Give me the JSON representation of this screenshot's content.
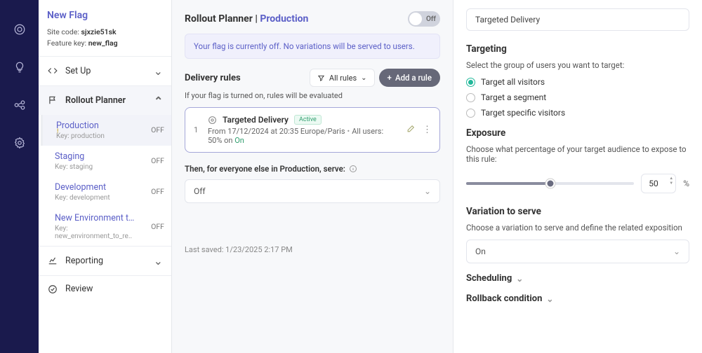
{
  "sidebar": {
    "title": "New Flag",
    "site_code_label": "Site code:",
    "site_code": "sjxzie51sk",
    "feature_key_label": "Feature key:",
    "feature_key": "new_flag",
    "setup": "Set Up",
    "rollout": "Rollout Planner",
    "reporting": "Reporting",
    "review": "Review",
    "envs": [
      {
        "name": "Production",
        "key": "Key: production",
        "status": "OFF"
      },
      {
        "name": "Staging",
        "key": "Key: staging",
        "status": "OFF"
      },
      {
        "name": "Development",
        "key": "Key: development",
        "status": "OFF"
      },
      {
        "name": "New Environment to re...",
        "key": "Key: new_environment_to_re..",
        "status": "OFF"
      }
    ]
  },
  "main": {
    "title_pre": "Rollout Planner | ",
    "title_env": "Production",
    "toggle_label": "Off",
    "notice": "Your flag is currently off. No variations will be served to users.",
    "delivery_title": "Delivery rules",
    "filter_label": "All rules",
    "add_rule_label": "Add a rule",
    "delivery_sub": "If your flag is turned on, rules will be evaluated",
    "rule": {
      "num": "1",
      "name": "Targeted Delivery",
      "badge": "Active",
      "date": "From 17/12/2024 at 20:35 Europe/Paris",
      "users": "All users: 50% on ",
      "on": "On"
    },
    "fallback_label": "Then, for everyone else in Production, serve:",
    "fallback_value": "Off",
    "last_saved": "Last saved: 1/23/2025  2:17 PM"
  },
  "right": {
    "input_value": "Targeted Delivery",
    "targeting_h": "Targeting",
    "targeting_sub": "Select the group of users you want to target:",
    "radio1": "Target all visitors",
    "radio2": "Target a segment",
    "radio3": "Target specific visitors",
    "exposure_h": "Exposure",
    "exposure_sub": "Choose what percentage of your target audience to expose to this rule:",
    "exposure_val": "50",
    "pct": "%",
    "variation_h": "Variation to serve",
    "variation_sub": "Choose a variation to serve and define the related exposition",
    "variation_val": "On",
    "scheduling_h": "Scheduling",
    "rollback_h": "Rollback condition"
  }
}
